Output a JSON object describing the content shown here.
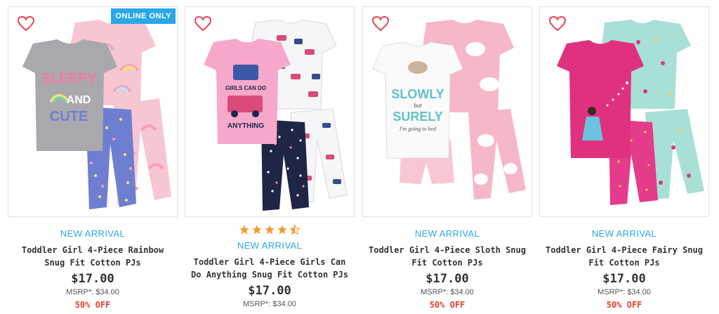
{
  "colors": {
    "accent": "#2aa7e6",
    "discount": "#e6402b",
    "star": "#f29b30",
    "heart": "#e8424e"
  },
  "products": [
    {
      "badge": "ONLINE ONLY",
      "arrival": "NEW ARRIVAL",
      "title": "Toddler Girl 4-Piece Rainbow Snug Fit Cotton PJs",
      "price": "$17.00",
      "msrp": "MSRP*: $34.00",
      "discount": "50% OFF",
      "shirt_text": [
        "SLEEPY",
        "AND",
        "CUTE"
      ]
    },
    {
      "rating": 4.5,
      "arrival": "NEW ARRIVAL",
      "title": "Toddler Girl 4-Piece Girls Can Do Anything Snug Fit Cotton PJs",
      "price": "$17.00",
      "msrp": "MSRP*: $34.00",
      "shirt_text": [
        "GIRLS CAN DO",
        "ANYTHING"
      ]
    },
    {
      "arrival": "NEW ARRIVAL",
      "title": "Toddler Girl 4-Piece Sloth Snug Fit Cotton PJs",
      "price": "$17.00",
      "msrp": "MSRP*: $34.00",
      "discount": "50% OFF",
      "shirt_text": [
        "SLOWLY",
        "but",
        "SURELY",
        "I'm going to bed"
      ]
    },
    {
      "arrival": "NEW ARRIVAL",
      "title": "Toddler Girl 4-Piece Fairy Snug Fit Cotton PJs",
      "price": "$17.00",
      "msrp": "MSRP*: $34.00",
      "discount": "50% OFF"
    }
  ]
}
